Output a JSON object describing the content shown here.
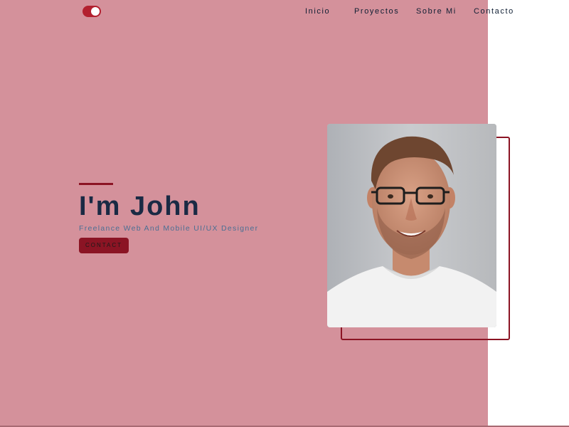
{
  "header": {
    "theme_toggle_state": "on",
    "nav": {
      "items": [
        {
          "label": "Inicio"
        },
        {
          "label": "Proyectos"
        },
        {
          "label": "Sobre Mi"
        },
        {
          "label": "Contacto"
        }
      ]
    }
  },
  "hero": {
    "title": "I'm John",
    "subtitle": "Freelance Web And Mobile UI/UX Designer",
    "contact_label": "CONTACT"
  },
  "colors": {
    "panel_background": "#d4919b",
    "accent": "#8b1424",
    "title": "#1a2a44",
    "subtitle": "#4a6f94"
  },
  "images": {
    "portrait": "portrait-photo"
  }
}
